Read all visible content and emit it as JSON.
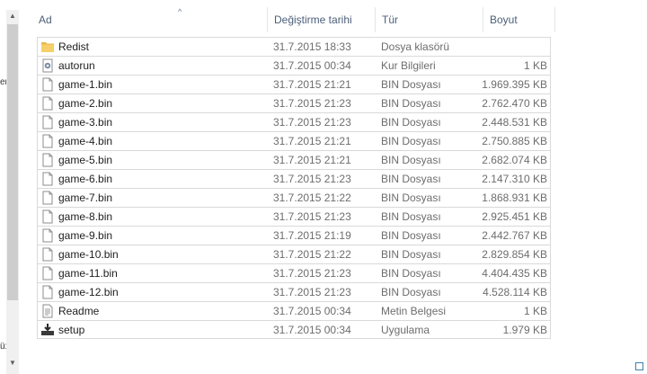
{
  "columns": {
    "name": "Ad",
    "date": "Değiştirme tarihi",
    "type": "Tür",
    "size": "Boyut"
  },
  "left_edge": {
    "char1": "er",
    "char2": "ü:"
  },
  "files": [
    {
      "name": "Redist",
      "date": "31.7.2015 18:33",
      "type": "Dosya klasörü",
      "size": "",
      "icon": "folder-icon"
    },
    {
      "name": "autorun",
      "date": "31.7.2015 00:34",
      "type": "Kur Bilgileri",
      "size": "1 KB",
      "icon": "settings-file-icon"
    },
    {
      "name": "game-1.bin",
      "date": "31.7.2015 21:21",
      "type": "BIN Dosyası",
      "size": "1.969.395 KB",
      "icon": "file-icon"
    },
    {
      "name": "game-2.bin",
      "date": "31.7.2015 21:23",
      "type": "BIN Dosyası",
      "size": "2.762.470 KB",
      "icon": "file-icon"
    },
    {
      "name": "game-3.bin",
      "date": "31.7.2015 21:23",
      "type": "BIN Dosyası",
      "size": "2.448.531 KB",
      "icon": "file-icon"
    },
    {
      "name": "game-4.bin",
      "date": "31.7.2015 21:21",
      "type": "BIN Dosyası",
      "size": "2.750.885 KB",
      "icon": "file-icon"
    },
    {
      "name": "game-5.bin",
      "date": "31.7.2015 21:21",
      "type": "BIN Dosyası",
      "size": "2.682.074 KB",
      "icon": "file-icon"
    },
    {
      "name": "game-6.bin",
      "date": "31.7.2015 21:23",
      "type": "BIN Dosyası",
      "size": "2.147.310 KB",
      "icon": "file-icon"
    },
    {
      "name": "game-7.bin",
      "date": "31.7.2015 21:22",
      "type": "BIN Dosyası",
      "size": "1.868.931 KB",
      "icon": "file-icon"
    },
    {
      "name": "game-8.bin",
      "date": "31.7.2015 21:23",
      "type": "BIN Dosyası",
      "size": "2.925.451 KB",
      "icon": "file-icon"
    },
    {
      "name": "game-9.bin",
      "date": "31.7.2015 21:19",
      "type": "BIN Dosyası",
      "size": "2.442.767 KB",
      "icon": "file-icon"
    },
    {
      "name": "game-10.bin",
      "date": "31.7.2015 21:22",
      "type": "BIN Dosyası",
      "size": "2.829.854 KB",
      "icon": "file-icon"
    },
    {
      "name": "game-11.bin",
      "date": "31.7.2015 21:23",
      "type": "BIN Dosyası",
      "size": "4.404.435 KB",
      "icon": "file-icon"
    },
    {
      "name": "game-12.bin",
      "date": "31.7.2015 21:23",
      "type": "BIN Dosyası",
      "size": "4.528.114 KB",
      "icon": "file-icon"
    },
    {
      "name": "Readme",
      "date": "31.7.2015 00:34",
      "type": "Metin Belgesi",
      "size": "1 KB",
      "icon": "text-document-icon"
    },
    {
      "name": "setup",
      "date": "31.7.2015 00:34",
      "type": "Uygulama",
      "size": "1.979 KB",
      "icon": "installer-icon"
    }
  ]
}
